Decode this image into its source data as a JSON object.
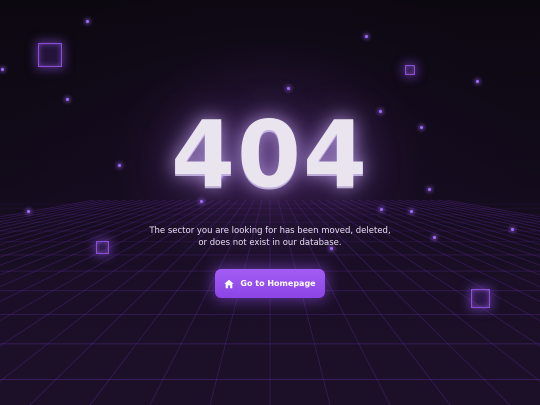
{
  "error": {
    "code": "404",
    "message_line1": "The sector you are looking for has been moved, deleted,",
    "message_line2": "or does not exist in our database."
  },
  "actions": {
    "home_button_label": "Go to Homepage",
    "home_button_icon": "home-icon"
  },
  "theme": {
    "accent": "#9b51f0",
    "background": "#0f0914",
    "grid_color": "#6a2fa8"
  }
}
